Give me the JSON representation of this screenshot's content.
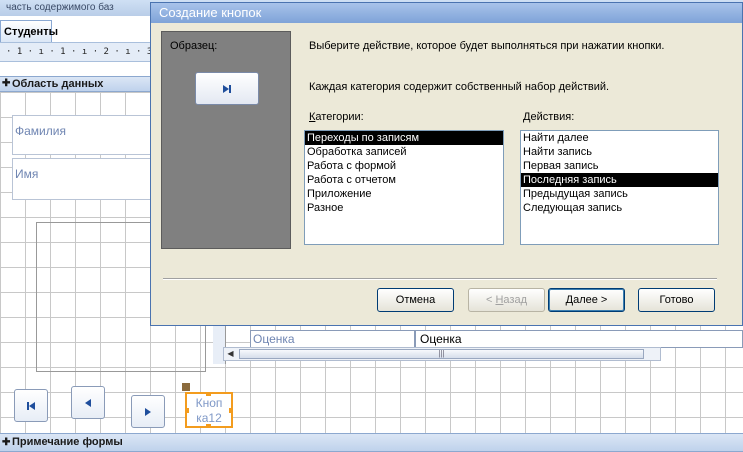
{
  "background": {
    "titlebar_text": "часть содержимого баз",
    "tab_label": "Студенты",
    "ruler_text": "· 1 · ı · 1 · ı · 2 · ı · 3 · ı · 4",
    "detail_section_label": "Область данных",
    "footer_section_label": "Примечание формы",
    "field_surname": "Фамилия",
    "field_name": "Имя",
    "grade_label": "Оценка",
    "grade_field": "Оценка",
    "new_button_text": "Кноп ка12",
    "scroll_thumb_grip": "|||"
  },
  "dialog": {
    "title": "Создание кнопок",
    "sample_label": "Образец:",
    "description_1": "Выберите действие, которое будет выполняться при нажатии кнопки.",
    "description_2": "Каждая категория содержит собственный набор действий.",
    "categories_label_first": "К",
    "categories_label_rest": "атегории:",
    "actions_label_first": "Д",
    "actions_label_rest": "ействия:",
    "categories": [
      "Переходы по записям",
      "Обработка записей",
      "Работа с формой",
      "Работа с отчетом",
      "Приложение",
      "Разное"
    ],
    "selected_category": "Переходы по записям",
    "actions": [
      "Найти далее",
      "Найти запись",
      "Первая запись",
      "Последняя запись",
      "Предыдущая запись",
      "Следующая запись"
    ],
    "selected_action": "Последняя запись",
    "buttons": {
      "cancel": "Отмена",
      "back_prefix": "< ",
      "back_hotkey": "Н",
      "back_rest": "азад",
      "next_hotkey": "Д",
      "next_rest": "алее >",
      "finish": "Готово"
    }
  },
  "colors": {
    "dialog_bg": "#ece9d8",
    "selection": "#000000",
    "selected_control_border": "#f39c1e",
    "sample_panel": "#808080"
  },
  "icons": {
    "sample": "last-record-icon",
    "nav_first": "first-record-icon",
    "nav_prev": "previous-record-icon",
    "nav_next": "next-record-icon"
  }
}
